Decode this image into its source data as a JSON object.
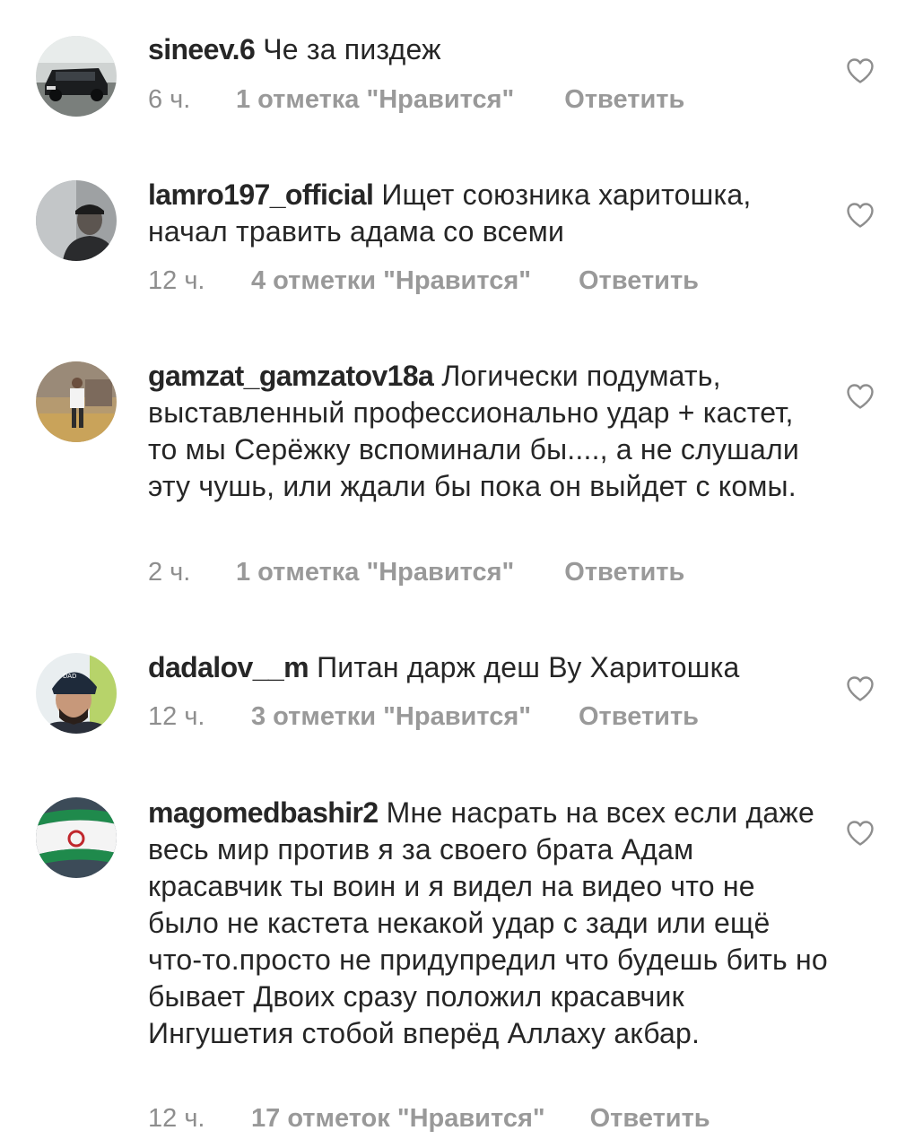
{
  "comments": [
    {
      "username": "sineev.6",
      "text": "Че за пиздеж",
      "time": "6 ч.",
      "likes": "1 отметка \"Нравится\"",
      "reply": "Ответить",
      "avatar_icon": "car-avatar-icon"
    },
    {
      "username": "lamro197_official",
      "text": "Ищет союзника харитошка, начал травить адама со всеми",
      "time": "12 ч.",
      "likes": "4 отметки \"Нравится\"",
      "reply": "Ответить",
      "avatar_icon": "person-avatar-icon"
    },
    {
      "username": "gamzat_gamzatov18a",
      "text": "Логически подумать, выставленный профессионально удар + кастет, то мы Серёжку вспоминали бы...., а не слушали эту чушь, или ждали бы пока он выйдет с комы.",
      "time": "2 ч.",
      "likes": "1 отметка \"Нравится\"",
      "reply": "Ответить",
      "avatar_icon": "gym-person-avatar-icon"
    },
    {
      "username": "dadalov__m",
      "text": "Питан дарж деш Ву Харитошка",
      "time": "12 ч.",
      "likes": "3 отметки \"Нравится\"",
      "reply": "Ответить",
      "avatar_icon": "beanie-person-avatar-icon"
    },
    {
      "username": "magomedbashir2",
      "text": "Мне насрать на всех если даже весь мир против я за своего брата Адам красавчик ты воин и я видел на видео что не было не кастета некакой удар с зади или ещё что-то.просто не придупредил что будешь бить но бывает Двоих сразу положил красавчик Ингушетия стобой вперёд Аллаху акбар.",
      "time": "12 ч.",
      "likes": "17 отметок \"Нравится\"",
      "reply": "Ответить",
      "avatar_icon": "flag-avatar-icon"
    }
  ],
  "colors": {
    "text": "#262626",
    "meta": "#8e8e8e",
    "heart_stroke": "#8e8e8e"
  },
  "icons": {
    "like": "heart-outline-icon"
  }
}
